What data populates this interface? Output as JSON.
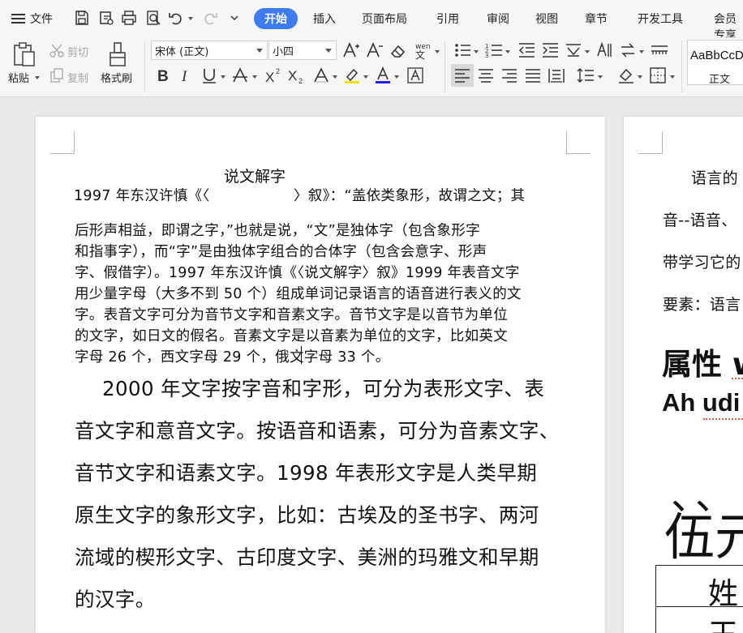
{
  "menubar": {
    "file_label": "文件",
    "tabs": [
      "开始",
      "插入",
      "页面布局",
      "引用",
      "审阅",
      "视图",
      "章节",
      "开发工具",
      "会员专享"
    ],
    "active_tab": "开始"
  },
  "ribbon": {
    "paste_label": "粘贴",
    "cut_label": "剪切",
    "copy_label": "复制",
    "format_painter_label": "格式刷",
    "font_name": "宋体 (正文)",
    "font_size": "小四",
    "style_sample": "AaBbCcDd",
    "style_name": "正文"
  },
  "page1": {
    "title": "说文解字",
    "line1a": "1997 年东汉许慎《〈",
    "line1b": "〉叙》：“盖依类象形，故谓之文；其",
    "para_small": [
      "后形声相益，即谓之字，”也就是说，“文”是独体字（包含象形字",
      "和指事字），而“字”是由独体字组合的合体字（包含会意字、形声",
      "字、假借字）。1997 年东汉许慎《〈说文解字〉叙》1999 年表音文字",
      "用少量字母（大多不到 50 个）组成单词记录语言的语音进行表义的文",
      "字。表音文字可分为音节文字和音素文字。音节文字是以音节为单位",
      "的文字，如日文的假名。音素文字是以音素为单位的文字，比如英文",
      "字母 26 个，西文字母 29 个，俄文字母 33 个。"
    ],
    "para_big": [
      "2000 年文字按字音和字形，可分为表形文字、表",
      "音文字和意音文字。按语音和语素，可分为音素文字、",
      "音节文字和语素文字。1998 年表形文字是人类早期",
      "原生文字的象形文字，比如：古埃及的圣书字、两河",
      "流域的楔形文字、古印度文字、美洲的玛雅文和早期",
      "的汉字。"
    ]
  },
  "page2": {
    "lines": [
      "语言的",
      "音--语音、",
      "带学习它的",
      "要素：语言"
    ],
    "heading1": "属性 w",
    "heading2": "Ah udi",
    "mark": "、、",
    "big_text": "伍元",
    "table_cells": [
      "姓",
      "王"
    ]
  }
}
